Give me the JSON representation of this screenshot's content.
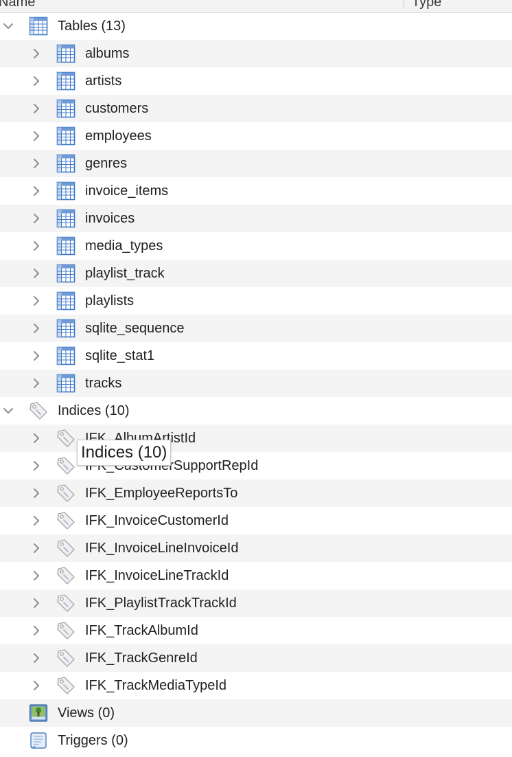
{
  "header": {
    "name_col": "Name",
    "type_col": "Type"
  },
  "groups": {
    "tables": {
      "label": "Tables (13)",
      "expanded": true,
      "icon": "table-icon",
      "items": [
        "albums",
        "artists",
        "customers",
        "employees",
        "genres",
        "invoice_items",
        "invoices",
        "media_types",
        "playlist_track",
        "playlists",
        "sqlite_sequence",
        "sqlite_stat1",
        "tracks"
      ]
    },
    "indices": {
      "label": "Indices (10)",
      "expanded": true,
      "icon": "tag-icon",
      "items": [
        "IFK_AlbumArtistId",
        "IFK_CustomerSupportRepId",
        "IFK_EmployeeReportsTo",
        "IFK_InvoiceCustomerId",
        "IFK_InvoiceLineInvoiceId",
        "IFK_InvoiceLineTrackId",
        "IFK_PlaylistTrackTrackId",
        "IFK_TrackAlbumId",
        "IFK_TrackGenreId",
        "IFK_TrackMediaTypeId"
      ]
    },
    "views": {
      "label": "Views (0)",
      "icon": "view-icon"
    },
    "triggers": {
      "label": "Triggers (0)",
      "icon": "trigger-icon"
    }
  },
  "tooltip": {
    "text": "Indices (10)"
  },
  "colors": {
    "row_alt": "#f4f4f4",
    "chevron": "#8e8e8e",
    "table_icon_blue": "#3d78c8"
  }
}
